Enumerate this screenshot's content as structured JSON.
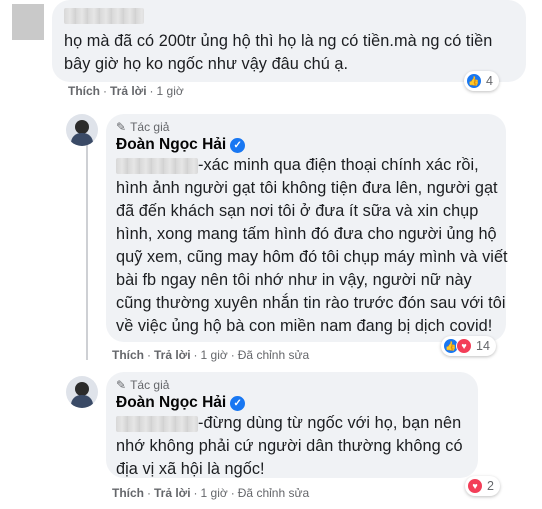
{
  "comment1": {
    "text": "họ mà đã có 200tr ủng hộ thì họ là ng có tiền.mà ng có tiền bây giờ họ ko ngốc như vậy đâu chú ạ.",
    "like_label": "Thích",
    "reply_label": "Trả lời",
    "time": "1 giờ",
    "reaction_count": "4"
  },
  "reply1": {
    "author_tag": "Tác giả",
    "author_name": "Đoàn Ngọc Hải",
    "text": "-xác minh qua điện thoại chính xác rồi, hình ảnh người gạt tôi không tiện đưa lên, người gạt đã đến khách sạn nơi tôi ở đưa ít sữa và xin chụp hình, xong mang tấm hình đó đưa cho người ủng hộ quỹ xem, cũng may hôm đó tôi chụp máy mình và viết bài fb ngay nên tôi nhớ như in vậy, người nữ này cũng thường xuyên nhắn tin rào trước đón sau với tôi về việc ủng hộ bà con miền nam đang bị dịch covid!",
    "like_label": "Thích",
    "reply_label": "Trả lời",
    "time": "1 giờ",
    "edited": "Đã chỉnh sửa",
    "reaction_count": "14"
  },
  "reply2": {
    "author_tag": "Tác giả",
    "author_name": "Đoàn Ngọc Hải",
    "text": "-đừng dùng từ ngốc với họ, bạn nên nhớ không phải cứ người dân thường không có địa vị xã hội là ngốc!",
    "like_label": "Thích",
    "reply_label": "Trả lời",
    "time": "1 giờ",
    "edited": "Đã chỉnh sửa",
    "reaction_count": "2"
  },
  "icons": {
    "like": "like-icon",
    "love": "love-icon",
    "verified": "verified-badge-icon",
    "author": "pen-icon"
  },
  "colors": {
    "bubble": "#f0f2f5",
    "meta_text": "#65676b",
    "like_blue": "#1877f2",
    "love_red": "#f33e58"
  }
}
